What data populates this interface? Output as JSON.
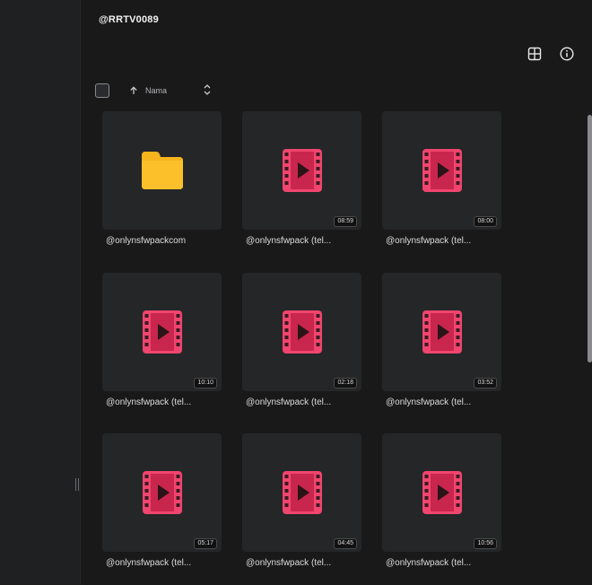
{
  "header": {
    "title": "@RRTV0089"
  },
  "toolbar": {
    "grid_view_icon": "grid-icon",
    "info_icon": "info-icon"
  },
  "sort": {
    "label": "Nama",
    "direction": "ascending"
  },
  "colors": {
    "video_icon": "#f0456e",
    "folder_icon": "#f6b51d",
    "tile_bg": "#252628",
    "page_bg": "#19191a"
  },
  "items": [
    {
      "type": "folder",
      "name": "@onlynsfwpackcom",
      "duration": ""
    },
    {
      "type": "video",
      "name": "@onlynsfwpack (tel...",
      "duration": "08:59"
    },
    {
      "type": "video",
      "name": "@onlynsfwpack (tel...",
      "duration": "08:00"
    },
    {
      "type": "video",
      "name": "@onlynsfwpack (tel...",
      "duration": "10:10"
    },
    {
      "type": "video",
      "name": "@onlynsfwpack (tel...",
      "duration": "02:18"
    },
    {
      "type": "video",
      "name": "@onlynsfwpack (tel...",
      "duration": "03:52"
    },
    {
      "type": "video",
      "name": "@onlynsfwpack (tel...",
      "duration": "05:17"
    },
    {
      "type": "video",
      "name": "@onlynsfwpack (tel...",
      "duration": "04:45"
    },
    {
      "type": "video",
      "name": "@onlynsfwpack (tel...",
      "duration": "10:56"
    }
  ]
}
